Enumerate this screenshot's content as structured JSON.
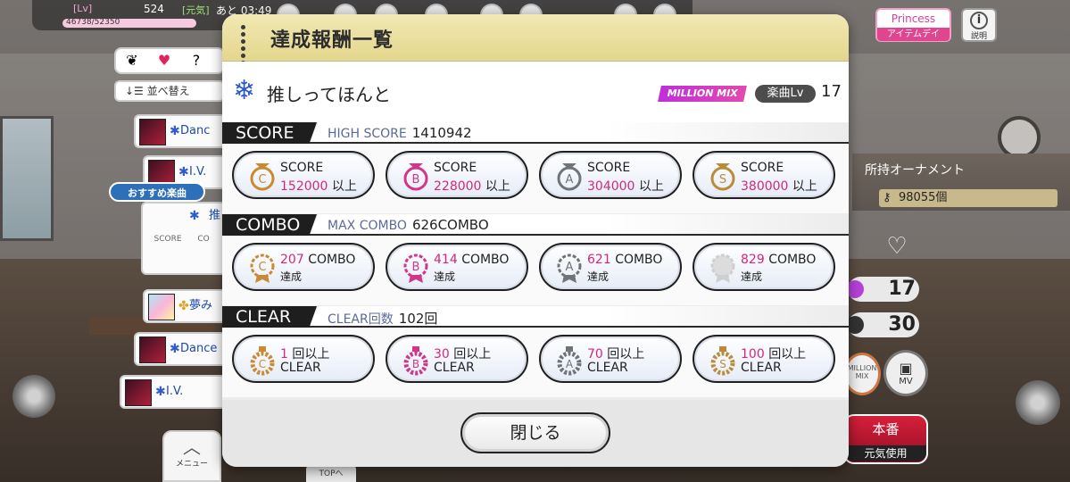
{
  "topbar": {
    "lv_label": "[Lv]",
    "lv_value": "524",
    "exp_text": "46738/52350",
    "genki_label": "[元気]",
    "genki_time": "あと 03:49"
  },
  "princess": {
    "label": "Princess",
    "sub": "アイテムデイ"
  },
  "info": {
    "icon": "i",
    "label": "説明"
  },
  "left": {
    "sort_label": "並べ替え",
    "recommend_label": "おすすめ楽曲",
    "songs": [
      {
        "label": "Danc"
      },
      {
        "label": "I.V."
      },
      {
        "label": "推"
      },
      {
        "label": "夢み"
      },
      {
        "label": "Dance"
      },
      {
        "label": "I.V."
      }
    ],
    "sel_score_label": "SCORE",
    "sel_combo_label": "CO",
    "menu_label": "メニュー",
    "top_label": "TOPへ"
  },
  "right": {
    "ornament_label": "所持オーナメント",
    "ornament_count": "98055個",
    "stat1": "17",
    "stat2": "30",
    "mv_label": "MV",
    "honban_label": "本番",
    "honban_sub": "元気使用"
  },
  "modal": {
    "title": "達成報酬一覧",
    "song_name": "推しってほんと",
    "mix_badge": "MILLION MIX",
    "lv_label": "楽曲Lv",
    "lv_value": "17",
    "close_label": "閉じる"
  },
  "sections": {
    "score": {
      "label": "SCORE",
      "sub_label": "HIGH SCORE",
      "sub_value": "1410942",
      "badges": [
        {
          "rank": "C",
          "line1": "SCORE",
          "value": "152000",
          "suffix": "以上",
          "color": "#c98a33"
        },
        {
          "rank": "B",
          "line1": "SCORE",
          "value": "228000",
          "suffix": "以上",
          "color": "#d2368b"
        },
        {
          "rank": "A",
          "line1": "SCORE",
          "value": "304000",
          "suffix": "以上",
          "color": "#6f7478"
        },
        {
          "rank": "S",
          "line1": "SCORE",
          "value": "380000",
          "suffix": "以上",
          "color": "#b88c3a"
        }
      ]
    },
    "combo": {
      "label": "COMBO",
      "sub_label": "MAX COMBO",
      "sub_value": "626COMBO",
      "badges": [
        {
          "rank": "C",
          "value": "207",
          "unit": "COMBO",
          "line2": "達成",
          "color": "#c98a33"
        },
        {
          "rank": "B",
          "value": "414",
          "unit": "COMBO",
          "line2": "達成",
          "color": "#d2368b"
        },
        {
          "rank": "A",
          "value": "621",
          "unit": "COMBO",
          "line2": "達成",
          "color": "#6f7478"
        },
        {
          "rank": "",
          "value": "829",
          "unit": "COMBO",
          "line2": "達成",
          "color": "#cfcfcf"
        }
      ]
    },
    "clear": {
      "label": "CLEAR",
      "sub_label": "CLEAR回数",
      "sub_value": "102回",
      "badges": [
        {
          "rank": "C",
          "value": "1",
          "unit": "回以上",
          "line2": "CLEAR",
          "color": "#c98a33"
        },
        {
          "rank": "B",
          "value": "30",
          "unit": "回以上",
          "line2": "CLEAR",
          "color": "#d2368b"
        },
        {
          "rank": "A",
          "value": "70",
          "unit": "回以上",
          "line2": "CLEAR",
          "color": "#6f7478"
        },
        {
          "rank": "S",
          "value": "100",
          "unit": "回以上",
          "line2": "CLEAR",
          "color": "#b88c3a"
        }
      ]
    }
  }
}
